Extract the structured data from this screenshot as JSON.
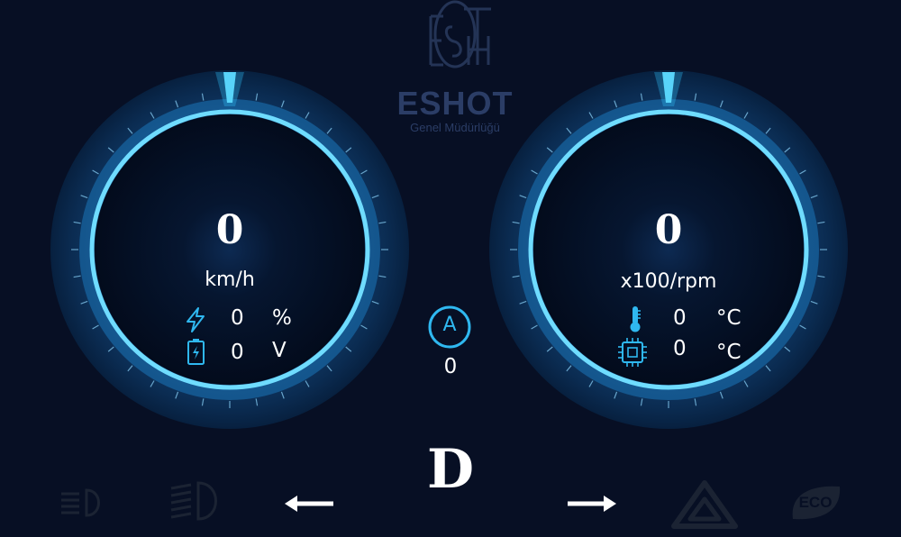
{
  "logo": {
    "brand": "ESHOT",
    "subtitle": "Genel Müdürlüğü"
  },
  "speed_gauge": {
    "value": "0",
    "unit": "km/h",
    "battery_percent_value": "0",
    "battery_percent_unit": "%",
    "voltage_value": "0",
    "voltage_unit": "V"
  },
  "rpm_gauge": {
    "value": "0",
    "unit": "x100/rpm",
    "coolant_temp_value": "0",
    "coolant_temp_unit": "°C",
    "controller_temp_value": "0",
    "controller_temp_unit": "°C"
  },
  "current": {
    "label": "A",
    "value": "0"
  },
  "gear": "D",
  "indicators": {
    "eco_label": "ECO"
  },
  "colors": {
    "background": "#070f24",
    "accent": "#2fb8f0",
    "ring": "#0f3a66",
    "inactive_icon": "#1b2333"
  }
}
